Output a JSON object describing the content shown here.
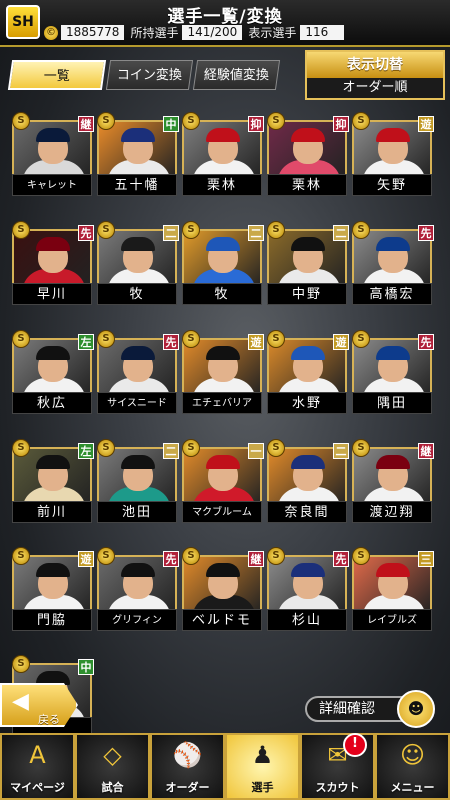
{
  "header": {
    "logo": "SH",
    "title": "選手一覧/変換",
    "coins": "1885778",
    "owned_label": "所持選手",
    "owned_value": "141/200",
    "shown_label": "表示選手",
    "shown_value": "116"
  },
  "tabs": [
    {
      "label": "一覧",
      "active": true
    },
    {
      "label": "コイン変換",
      "active": false
    },
    {
      "label": "経験値変換",
      "active": false
    }
  ],
  "display_toggle": {
    "label": "表示切替",
    "mode": "オーダー順"
  },
  "players": [
    {
      "name": "キャレット",
      "pos": "継",
      "pos_color": "#b0213a",
      "cap": "#0a1a3a",
      "body": "#d9d9d9",
      "bg": "#6a6a6a"
    },
    {
      "name": "五十幡",
      "pos": "中",
      "pos_color": "#2e8f2e",
      "cap": "#1b2f7a",
      "body": "#eaeaea",
      "bg": "#e88b2a"
    },
    {
      "name": "栗林",
      "pos": "抑",
      "pos_color": "#b0213a",
      "cap": "#c0101a",
      "body": "#f2f2f2",
      "bg": "#7d7d7d"
    },
    {
      "name": "栗林",
      "pos": "抑",
      "pos_color": "#b0213a",
      "cap": "#c0101a",
      "body": "#e04a6a",
      "bg": "#6f2a48"
    },
    {
      "name": "矢野",
      "pos": "遊",
      "pos_color": "#c29a24",
      "cap": "#c0101a",
      "body": "#f2f2f2",
      "bg": "#8a8a8a"
    },
    {
      "name": "早川",
      "pos": "先",
      "pos_color": "#b0213a",
      "cap": "#7a0010",
      "body": "#c81a2a",
      "bg": "#3a1010"
    },
    {
      "name": "牧",
      "pos": "二",
      "pos_color": "#c9a94a",
      "cap": "#1a1a1a",
      "body": "#f2f2f2",
      "bg": "#7a7a7a"
    },
    {
      "name": "牧",
      "pos": "二",
      "pos_color": "#c9a94a",
      "cap": "#1e57b8",
      "body": "#2a6bd6",
      "bg": "#e09a2a"
    },
    {
      "name": "中野",
      "pos": "二",
      "pos_color": "#c9a94a",
      "cap": "#111",
      "body": "#eaeaea",
      "bg": "#8a6a2a"
    },
    {
      "name": "高橋宏",
      "pos": "先",
      "pos_color": "#b0213a",
      "cap": "#0d3b8c",
      "body": "#f2f2f2",
      "bg": "#8a8a8a"
    },
    {
      "name": "秋広",
      "pos": "左",
      "pos_color": "#2e8f2e",
      "cap": "#111",
      "body": "#f2f2f2",
      "bg": "#7a7a7a"
    },
    {
      "name": "サイスニード",
      "pos": "先",
      "pos_color": "#b0213a",
      "cap": "#0a1a3a",
      "body": "#eaeaea",
      "bg": "#6a6a6a"
    },
    {
      "name": "エチェバリア",
      "pos": "遊",
      "pos_color": "#c29a24",
      "cap": "#111",
      "body": "#f2f2f2",
      "bg": "#e08a2a"
    },
    {
      "name": "水野",
      "pos": "遊",
      "pos_color": "#c29a24",
      "cap": "#1e57b8",
      "body": "#f2f2f2",
      "bg": "#d9892a"
    },
    {
      "name": "隅田",
      "pos": "先",
      "pos_color": "#b0213a",
      "cap": "#0d3b8c",
      "body": "#f2f2f2",
      "bg": "#8a8a8a"
    },
    {
      "name": "前川",
      "pos": "左",
      "pos_color": "#2e8f2e",
      "cap": "#111",
      "body": "#e8d8b0",
      "bg": "#5a5a3a"
    },
    {
      "name": "池田",
      "pos": "二",
      "pos_color": "#c9a94a",
      "cap": "#111",
      "body": "#1d9a8a",
      "bg": "#7a7a7a"
    },
    {
      "name": "マクブルーム",
      "pos": "一",
      "pos_color": "#c9a94a",
      "cap": "#c0101a",
      "body": "#d01a2a",
      "bg": "#e08a2a"
    },
    {
      "name": "奈良間",
      "pos": "二",
      "pos_color": "#c9a94a",
      "cap": "#1b2f7a",
      "body": "#f2f2f2",
      "bg": "#e08a2a"
    },
    {
      "name": "渡辺翔",
      "pos": "継",
      "pos_color": "#b0213a",
      "cap": "#7a0010",
      "body": "#f2f2f2",
      "bg": "#8a8a8a"
    },
    {
      "name": "門脇",
      "pos": "遊",
      "pos_color": "#c29a24",
      "cap": "#111",
      "body": "#f2f2f2",
      "bg": "#7a7a7a"
    },
    {
      "name": "グリフィン",
      "pos": "先",
      "pos_color": "#b0213a",
      "cap": "#111",
      "body": "#f2f2f2",
      "bg": "#6a6a6a"
    },
    {
      "name": "ベルドモ",
      "pos": "継",
      "pos_color": "#b0213a",
      "cap": "#111",
      "body": "#1a1a1a",
      "bg": "#e08a2a"
    },
    {
      "name": "杉山",
      "pos": "先",
      "pos_color": "#b0213a",
      "cap": "#1b2f7a",
      "body": "#eaeaea",
      "bg": "#8a8a8a"
    },
    {
      "name": "レイブルズ",
      "pos": "三",
      "pos_color": "#c29a24",
      "cap": "#c0101a",
      "body": "#f2f2f2",
      "bg": "#e06a4a"
    },
    {
      "name": "",
      "pos": "中",
      "pos_color": "#2e8f2e",
      "cap": "#111",
      "body": "#eaeaea",
      "bg": "#6a6a6a"
    }
  ],
  "back_label": "戻る",
  "detail_label": "詳細確認",
  "nav": [
    {
      "label": "マイページ",
      "icon": "A",
      "active": false
    },
    {
      "label": "試合",
      "icon": "◇",
      "active": false
    },
    {
      "label": "オーダー",
      "icon": "⚾",
      "active": false
    },
    {
      "label": "選手",
      "icon": "♟",
      "active": true
    },
    {
      "label": "スカウト",
      "icon": "✉",
      "active": false,
      "badge": "!"
    },
    {
      "label": "メニュー",
      "icon": "☺",
      "active": false
    }
  ]
}
